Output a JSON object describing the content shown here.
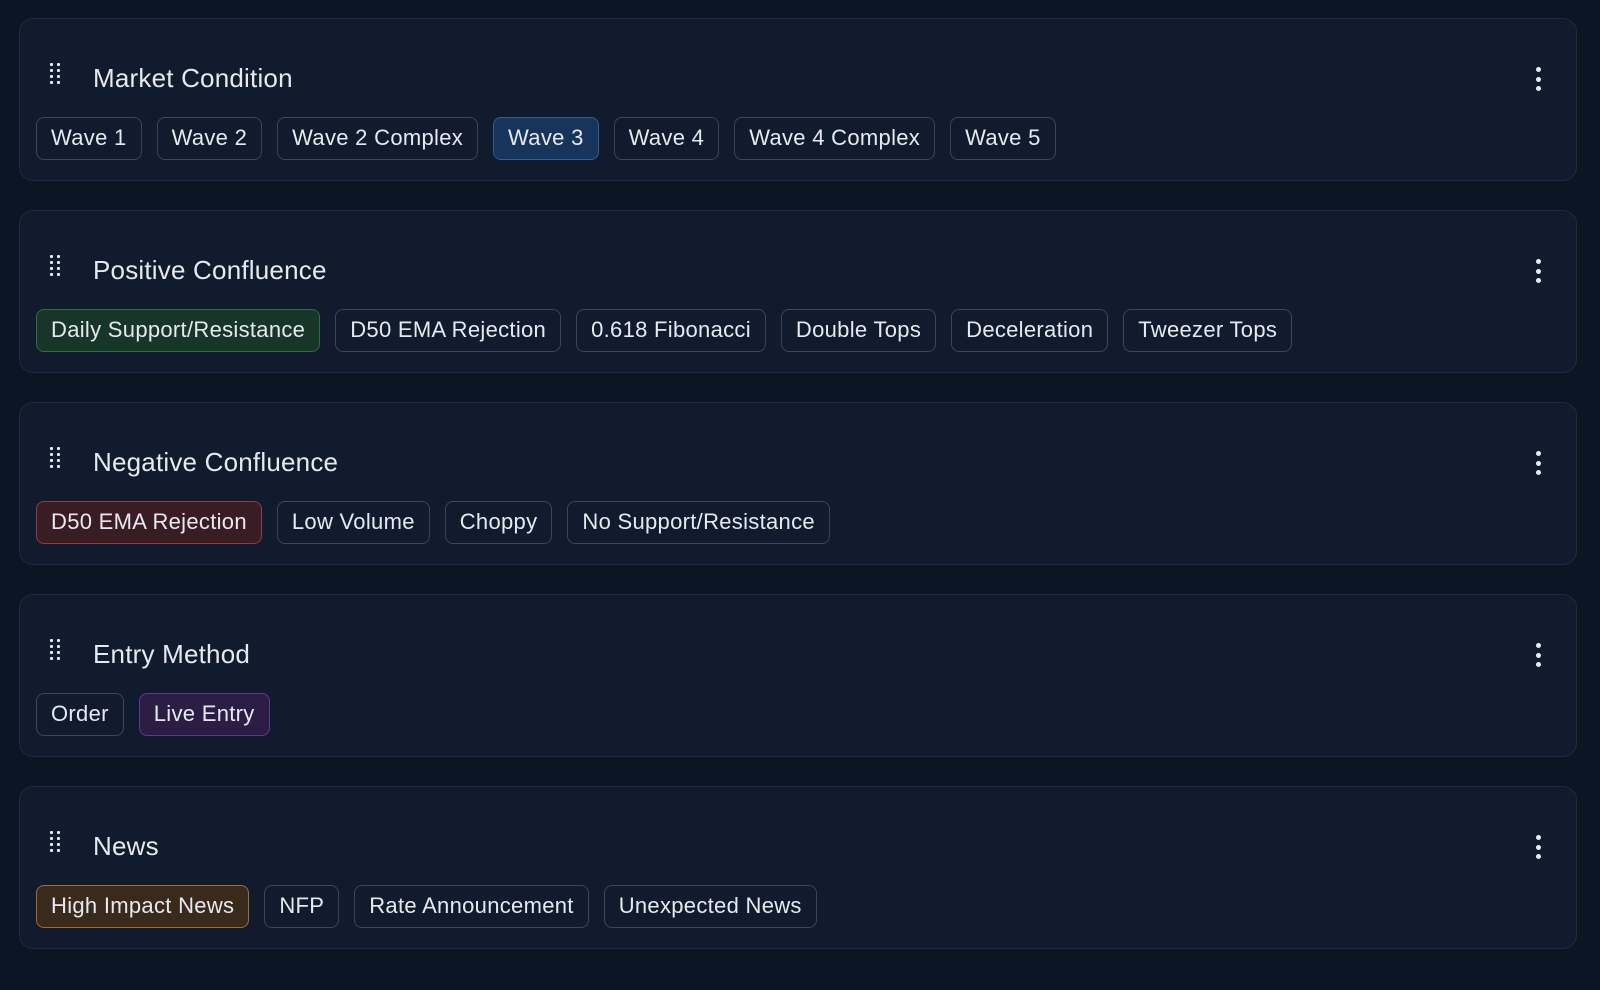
{
  "sections": [
    {
      "title": "Market Condition",
      "tags": [
        {
          "label": "Wave 1",
          "selected": false
        },
        {
          "label": "Wave 2",
          "selected": false
        },
        {
          "label": "Wave 2 Complex",
          "selected": false
        },
        {
          "label": "Wave 3",
          "selected": true,
          "color": "#2f5f97"
        },
        {
          "label": "Wave 4",
          "selected": false
        },
        {
          "label": "Wave 4 Complex",
          "selected": false
        },
        {
          "label": "Wave 5",
          "selected": false
        }
      ]
    },
    {
      "title": "Positive Confluence",
      "tags": [
        {
          "label": "Daily Support/Resistance",
          "selected": true,
          "color": "#2f6e45"
        },
        {
          "label": "D50 EMA Rejection",
          "selected": false
        },
        {
          "label": "0.618 Fibonacci",
          "selected": false
        },
        {
          "label": "Double Tops",
          "selected": false
        },
        {
          "label": "Deceleration",
          "selected": false
        },
        {
          "label": "Tweezer Tops",
          "selected": false
        }
      ]
    },
    {
      "title": "Negative Confluence",
      "tags": [
        {
          "label": "D50 EMA Rejection",
          "selected": true,
          "color": "#8a3d45"
        },
        {
          "label": "Low Volume",
          "selected": false
        },
        {
          "label": "Choppy",
          "selected": false
        },
        {
          "label": "No Support/Resistance",
          "selected": false
        }
      ]
    },
    {
      "title": "Entry Method",
      "tags": [
        {
          "label": "Order",
          "selected": false
        },
        {
          "label": "Live Entry",
          "selected": true,
          "color": "#5c3c8c"
        }
      ]
    },
    {
      "title": "News",
      "tags": [
        {
          "label": "High Impact News",
          "selected": true,
          "color": "#a06b35"
        },
        {
          "label": "NFP",
          "selected": false
        },
        {
          "label": "Rate Announcement",
          "selected": false
        },
        {
          "label": "Unexpected News",
          "selected": false
        }
      ]
    }
  ],
  "icons": {
    "drag_handle": "drag-handle-icon",
    "menu": "more-vertical-icon"
  },
  "colors": {
    "background": "#0c1524",
    "card": "#101b2e",
    "card_border": "#1e2b40",
    "tag_border": "#3a4659",
    "text": "#e6eaf0"
  }
}
